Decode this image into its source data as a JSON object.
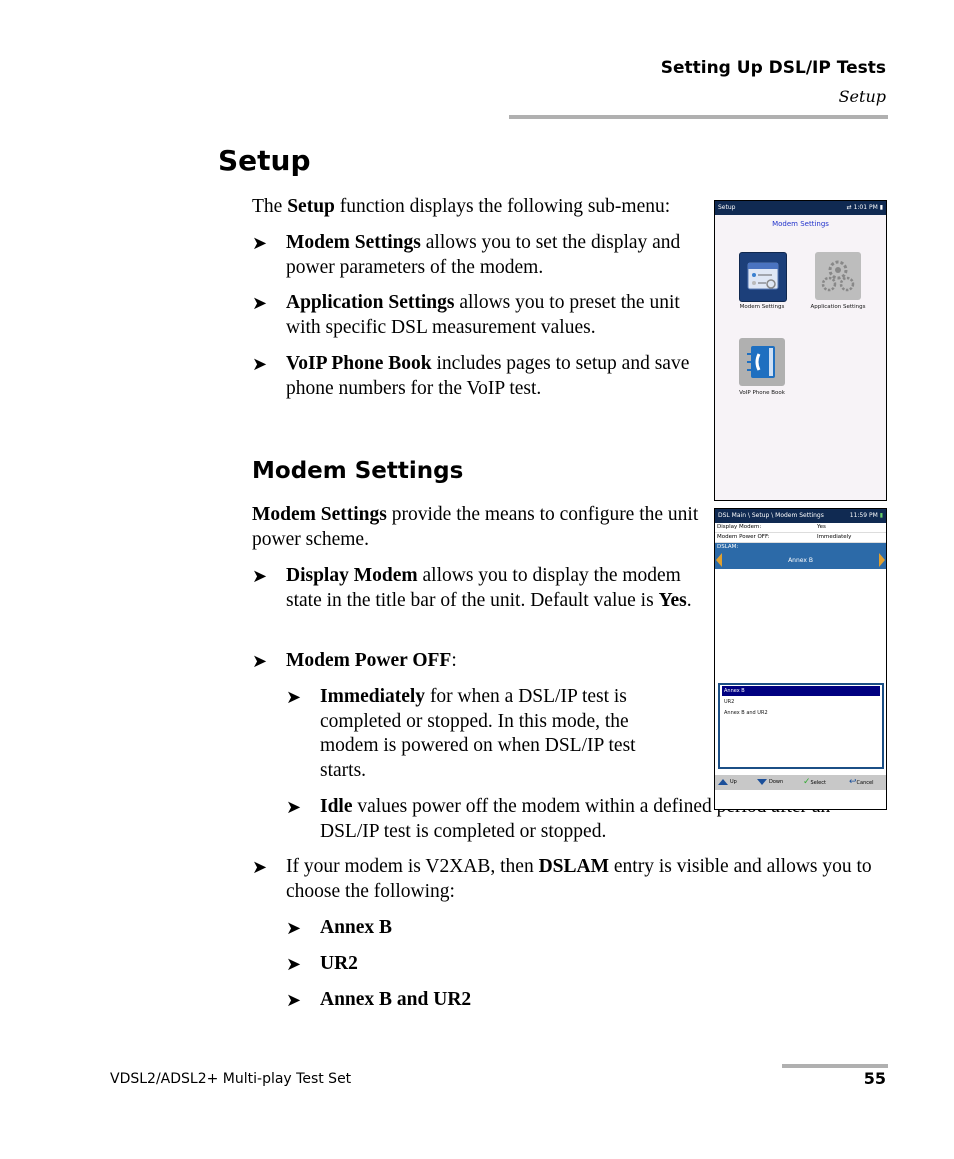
{
  "header": {
    "chapter": "Setting Up DSL/IP Tests",
    "section": "Setup"
  },
  "setup": {
    "heading": "Setup",
    "intro_pre": "The ",
    "intro_bold": "Setup",
    "intro_post": " function displays the following sub-menu:",
    "items": [
      {
        "bold": "Modem Settings",
        "text": " allows you to set the display and power parameters of the modem."
      },
      {
        "bold": "Application Settings",
        "text": " allows you to preset the unit with specific DSL measurement values."
      },
      {
        "bold": "VoIP Phone Book",
        "text": " includes pages to setup and save phone numbers for the VoIP test."
      }
    ]
  },
  "modem": {
    "heading": "Modem Settings",
    "intro_bold": "Modem Settings",
    "intro_post": " provide the means to configure the unit power scheme.",
    "display_bold": "Display Modem",
    "display_text": " allows you to display the modem state in the title bar of the unit. Default value is ",
    "display_default": "Yes",
    "power_bold": "Modem Power OFF",
    "power_colon": ":",
    "sub_items": [
      {
        "bold": "Immediately",
        "text": " for when a DSL/IP test is completed or stopped. In this mode, the modem is powered on when DSL/IP test starts."
      },
      {
        "bold": "Idle",
        "text": " values power off the modem within a defined period after an DSL/IP test is completed or stopped."
      }
    ],
    "dslam_pre": "If your modem is V2XAB, then ",
    "dslam_bold": "DSLAM",
    "dslam_post": " entry is visible and allows you to choose the following:",
    "dslam_options": [
      "Annex B",
      "UR2",
      "Annex B and UR2"
    ]
  },
  "screen1": {
    "title": "Setup",
    "time": "1:01 PM",
    "heading": "Modem Settings",
    "tiles": [
      {
        "label": "Modem Settings",
        "icon": "modem-settings-icon"
      },
      {
        "label": "Application Settings",
        "icon": "gears-icon"
      },
      {
        "label": "VoIP Phone Book",
        "icon": "phone-book-icon"
      }
    ]
  },
  "screen2": {
    "breadcrumb": "DSL Main \\ Setup \\ Modem Settings",
    "time": "11:59 PM",
    "rows": [
      {
        "label": "Display Modem:",
        "value": "Yes"
      },
      {
        "label": "Modem Power OFF:",
        "value": "Immediately"
      }
    ],
    "dslam_label": "DSLAM:",
    "dslam_value": "Annex B",
    "list_options": [
      "Annex B",
      "UR2",
      "Annex B and UR2"
    ],
    "selected_index": 0,
    "softkeys": [
      "Up",
      "Down",
      "Select",
      "Cancel"
    ]
  },
  "footer": {
    "product": "VDSL2/ADSL2+ Multi-play Test Set",
    "page": "55"
  }
}
